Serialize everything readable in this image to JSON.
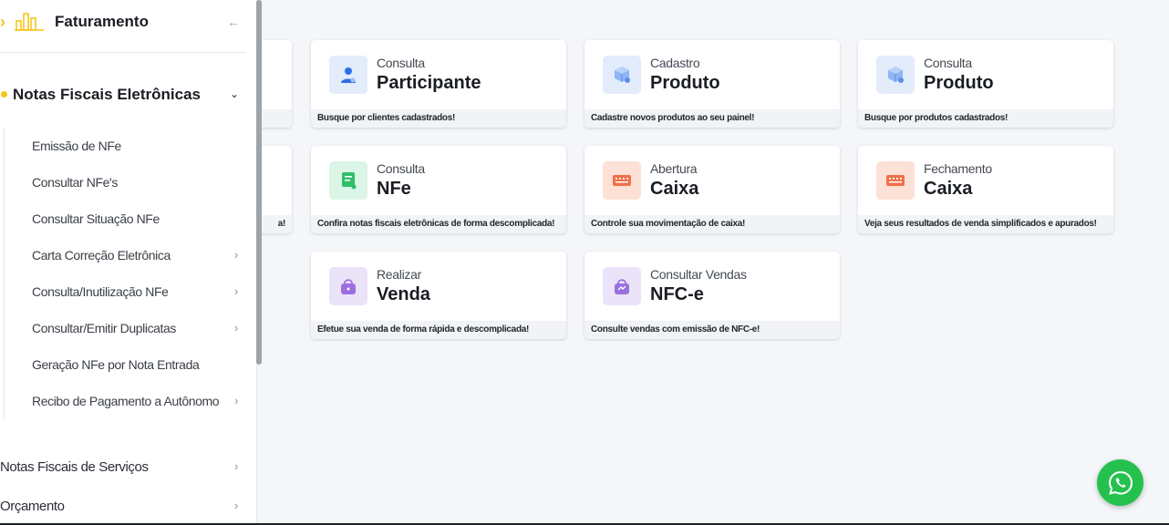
{
  "sidebar": {
    "header_title": "Faturamento",
    "section_title": "Notas Fiscais Eletrônicas",
    "sub_items": [
      {
        "label": "Emissão de NFe",
        "has_arrow": false
      },
      {
        "label": "Consultar NFe's",
        "has_arrow": false
      },
      {
        "label": "Consultar Situação NFe",
        "has_arrow": false
      },
      {
        "label": "Carta Correção Eletrônica",
        "has_arrow": true
      },
      {
        "label": "Consulta/Inutilização NFe",
        "has_arrow": true
      },
      {
        "label": "Consultar/Emitir Duplicatas",
        "has_arrow": true
      },
      {
        "label": "Geração NFe por Nota Entrada",
        "has_arrow": false
      },
      {
        "label": "Recibo de Pagamento a Autônomo",
        "has_arrow": true
      }
    ],
    "top_items": [
      {
        "label": "Notas Fiscais de Serviços"
      },
      {
        "label": "Orçamento"
      }
    ],
    "accent_color": "#f5c518"
  },
  "partial_cards": [
    {
      "footer": ""
    },
    {
      "footer": "a!"
    }
  ],
  "cards": [
    {
      "small": "Consulta",
      "big": "Participante",
      "footer": "Busque por clientes cadastrados!",
      "icon": "user-icon",
      "icon_bg": "#e3ecfb",
      "icon_color": "#2f6fe4"
    },
    {
      "small": "Cadastro",
      "big": "Produto",
      "footer": "Cadastre novos produtos ao seu painel!",
      "icon": "box-icon",
      "icon_bg": "#e3ecfb",
      "icon_color": "#6aa0f0"
    },
    {
      "small": "Consulta",
      "big": "Produto",
      "footer": "Busque por produtos cadastrados!",
      "icon": "box-icon",
      "icon_bg": "#e3ecfb",
      "icon_color": "#6aa0f0"
    },
    {
      "small": "Consulta",
      "big": "NFe",
      "footer": "Confira notas fiscais eletrônicas de forma descomplicada!",
      "icon": "receipt-icon",
      "icon_bg": "#dbf5e6",
      "icon_color": "#2fbf6a"
    },
    {
      "small": "Abertura",
      "big": "Caixa",
      "footer": "Controle sua movimentação de caixa!",
      "icon": "cash-register-icon",
      "icon_bg": "#fde0d6",
      "icon_color": "#f0704a"
    },
    {
      "small": "Fechamento",
      "big": "Caixa",
      "footer": "Veja seus resultados de venda simplificados e apurados!",
      "icon": "cash-register-icon",
      "icon_bg": "#fde0d6",
      "icon_color": "#f0704a"
    },
    {
      "small": "Realizar",
      "big": "Venda",
      "footer": "Efetue sua venda de forma rápida e descomplicada!",
      "icon": "shopping-bag-icon",
      "icon_bg": "#ebe3f8",
      "icon_color": "#9b6fe0"
    },
    {
      "small": "Consultar Vendas",
      "big": "NFC-e",
      "footer": "Consulte vendas com emissão de NFC-e!",
      "icon": "shopping-bag-icon",
      "icon_bg": "#ebe3f8",
      "icon_color": "#9b6fe0"
    }
  ],
  "whatsapp_icon": "whatsapp-icon",
  "whatsapp_color": "#25c14f"
}
